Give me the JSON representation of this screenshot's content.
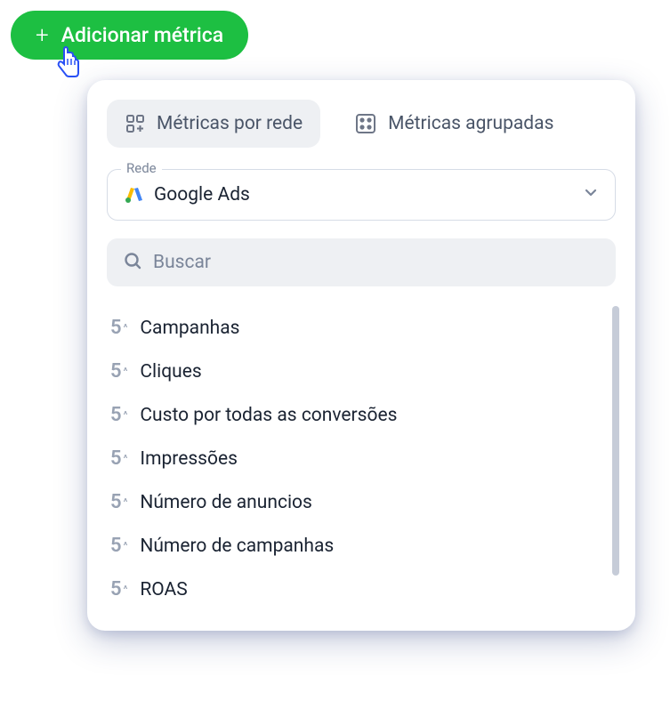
{
  "addButton": {
    "label": "Adicionar métrica"
  },
  "tabs": [
    {
      "label": "Métricas por rede",
      "active": true
    },
    {
      "label": "Métricas agrupadas",
      "active": false
    }
  ],
  "network": {
    "fieldLabel": "Rede",
    "selected": "Google Ads"
  },
  "search": {
    "placeholder": "Buscar"
  },
  "metrics": [
    {
      "label": "Campanhas"
    },
    {
      "label": "Cliques"
    },
    {
      "label": "Custo por todas as conversões"
    },
    {
      "label": "Impressões"
    },
    {
      "label": "Número de anuncios"
    },
    {
      "label": "Número de campanhas"
    },
    {
      "label": "ROAS"
    }
  ]
}
